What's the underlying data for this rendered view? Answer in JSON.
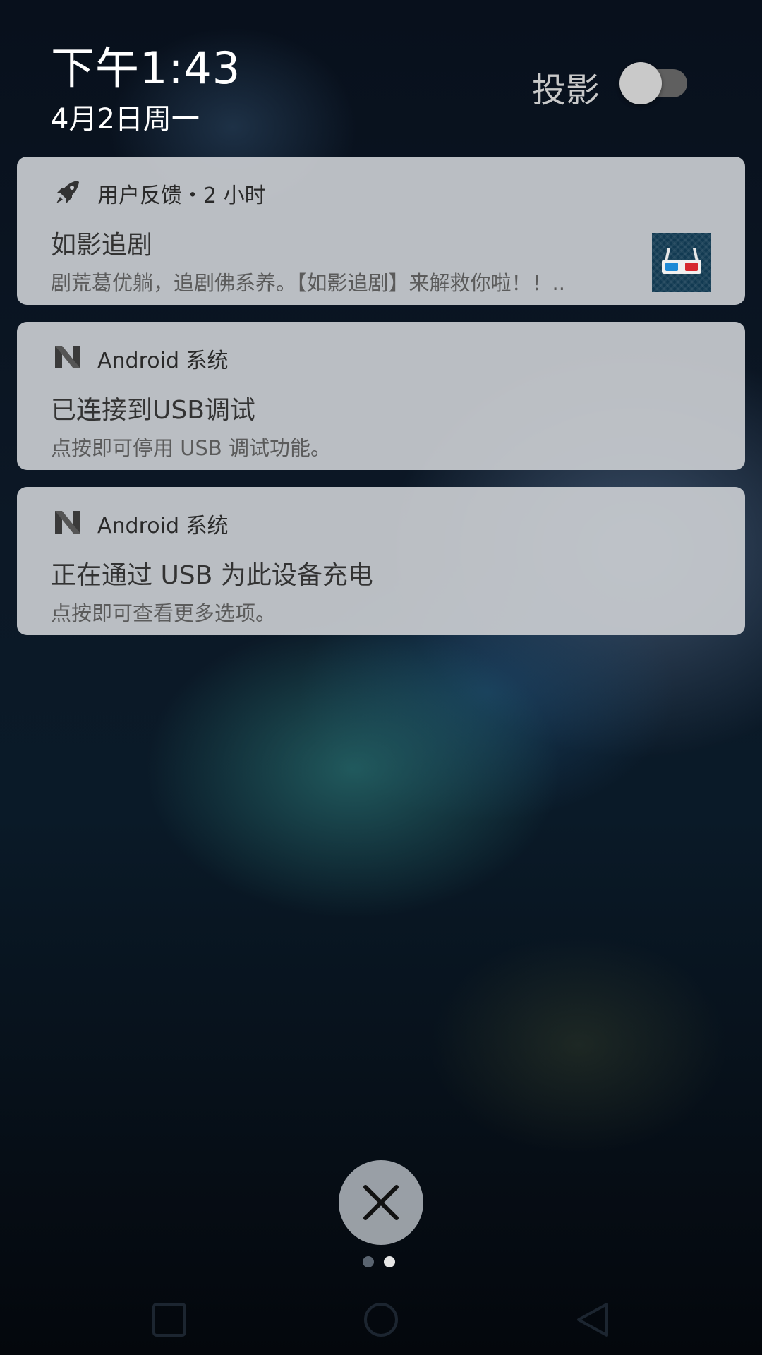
{
  "header": {
    "time": "下午1:43",
    "date": "4月2日周一",
    "cast_label": "投影",
    "cast_toggle_on": false
  },
  "notifications": [
    {
      "app_name": "用户反馈・2 小时",
      "icon": "rocket-icon",
      "title": "如影追剧",
      "body": "剧荒葛优躺，追剧佛系养。【如影追剧】来解救你啦！！..",
      "thumbnail": "3d-glasses-icon"
    },
    {
      "app_name": "Android 系统",
      "icon": "android-n-icon",
      "title": "已连接到USB调试",
      "body": "点按即可停用 USB 调试功能。"
    },
    {
      "app_name": "Android 系统",
      "icon": "android-n-icon",
      "title": "正在通过 USB 为此设备充电",
      "body": "点按即可查看更多选项。"
    }
  ],
  "pager": {
    "page_count": 2,
    "current_page": 2
  },
  "close_button": {
    "icon": "close-icon"
  },
  "navbar": {
    "recent_icon": "recent-apps-icon",
    "home_icon": "home-icon",
    "back_icon": "back-icon"
  }
}
